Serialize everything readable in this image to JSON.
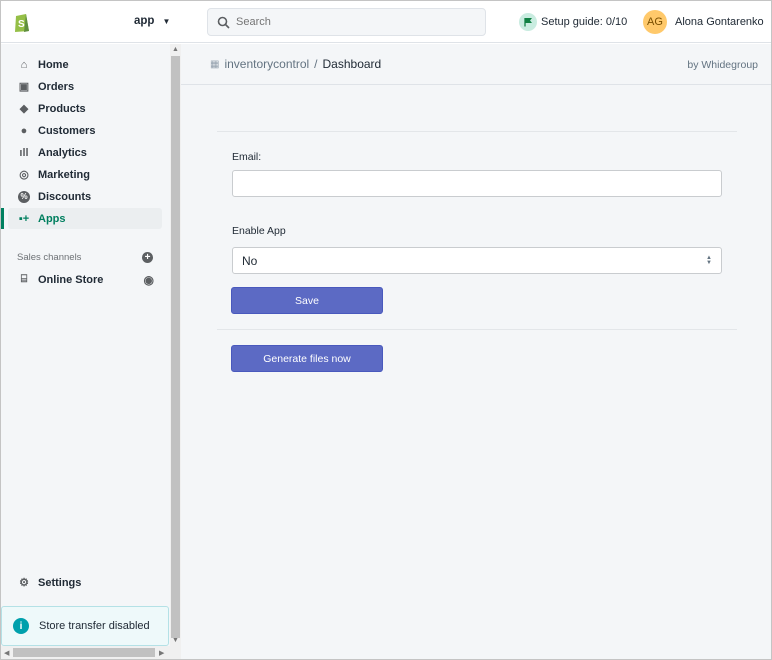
{
  "topbar": {
    "store_name": "app",
    "search_placeholder": "Search",
    "setup_guide": "Setup guide: 0/10",
    "user_initials": "AG",
    "user_name": "Alona Gontarenko"
  },
  "sidebar": {
    "items": [
      {
        "label": "Home",
        "icon": "home-icon"
      },
      {
        "label": "Orders",
        "icon": "orders-icon"
      },
      {
        "label": "Products",
        "icon": "tag-icon"
      },
      {
        "label": "Customers",
        "icon": "person-icon"
      },
      {
        "label": "Analytics",
        "icon": "bar-chart-icon"
      },
      {
        "label": "Marketing",
        "icon": "target-icon"
      },
      {
        "label": "Discounts",
        "icon": "discount-icon"
      },
      {
        "label": "Apps",
        "icon": "apps-icon",
        "active": true
      }
    ],
    "sales_channels_label": "Sales channels",
    "online_store": "Online Store",
    "settings": "Settings",
    "store_transfer": "Store transfer disabled"
  },
  "header": {
    "app_name": "inventorycontrol",
    "separator": "/",
    "page": "Dashboard",
    "by": "by Whidegroup"
  },
  "form": {
    "email_label": "Email:",
    "email_value": "",
    "enable_label": "Enable App",
    "enable_value": "No",
    "save_label": "Save",
    "generate_label": "Generate files now"
  },
  "colors": {
    "accent": "#5c6ac4",
    "active_nav": "#008060",
    "shopify_green": "#95bf47"
  }
}
